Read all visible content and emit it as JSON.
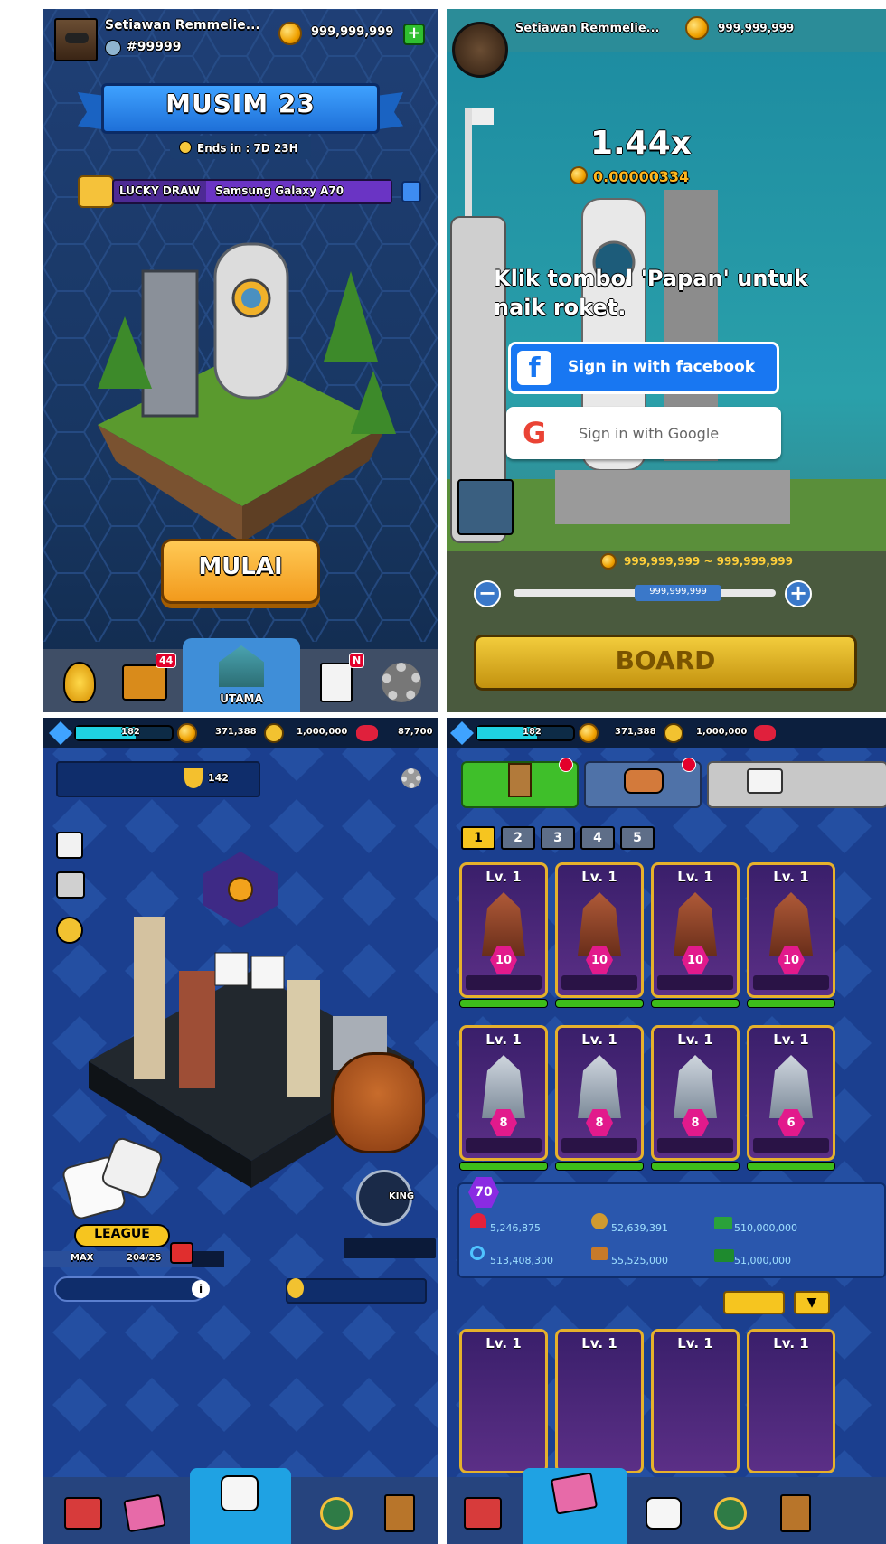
{
  "panel1": {
    "player_name": "Setiawan Remmelie...",
    "player_id": "#99999",
    "coins": "999,999,999",
    "season_title": "MUSIM 23",
    "ends_in": "Ends in : 7D 23H",
    "lucky_draw_label": "LUCKY DRAW",
    "lucky_draw_prize": "Samsung Galaxy A70",
    "start_button": "MULAI",
    "nav": {
      "chest_badge": "44",
      "home_label": "UTAMA",
      "notes_badge": "N"
    }
  },
  "panel2": {
    "player_name": "Setiawan Remmelie...",
    "coins": "999,999,999",
    "multiplier": "1.44x",
    "coin_amount": "0.00000334",
    "instruction": "Klik tombol 'Papan' untuk naik roket.",
    "facebook_button": "Sign in with facebook",
    "google_button": "Sign in with Google",
    "range_text": "999,999,999 ~ 999,999,999",
    "slider_value": "999,999,999",
    "board_button": "BOARD"
  },
  "panel3": {
    "level": "182",
    "coins": "371,388",
    "dice_count": "1,000,000",
    "gems": "87,700",
    "trophies": "142",
    "league_label": "LEAGUE",
    "league_max": "MAX",
    "league_progress": "204/25",
    "league_progress_fraction": 0.82,
    "king_label": "KING"
  },
  "panel4": {
    "level": "182",
    "coins": "371,388",
    "dice_count": "1,000,000",
    "tabs": [
      "1",
      "2",
      "3",
      "4",
      "5"
    ],
    "card_rows": [
      [
        {
          "lv": "Lv. 1",
          "num": "10"
        },
        {
          "lv": "Lv. 1",
          "num": "10"
        },
        {
          "lv": "Lv. 1",
          "num": "10"
        },
        {
          "lv": "Lv. 1",
          "num": "10"
        }
      ],
      [
        {
          "lv": "Lv. 1",
          "num": "8"
        },
        {
          "lv": "Lv. 1",
          "num": "8"
        },
        {
          "lv": "Lv. 1",
          "num": "8"
        },
        {
          "lv": "Lv. 1",
          "num": "6"
        }
      ]
    ],
    "stats_level": "70",
    "stats": {
      "s1": "5,246,875",
      "s2": "52,639,391",
      "s3": "510,000,000",
      "s4": "513,408,300",
      "s5": "55,525,000",
      "s6": "51,000,000"
    },
    "bottom_cards": [
      "Lv. 1",
      "Lv. 1",
      "Lv. 1",
      "Lv. 1"
    ]
  },
  "colors": {
    "gold": "#f0a100",
    "blue_bg": "#1b3f8f",
    "facebook": "#1877f2",
    "board": "#d9ab1f",
    "start": "#f29a1c"
  }
}
